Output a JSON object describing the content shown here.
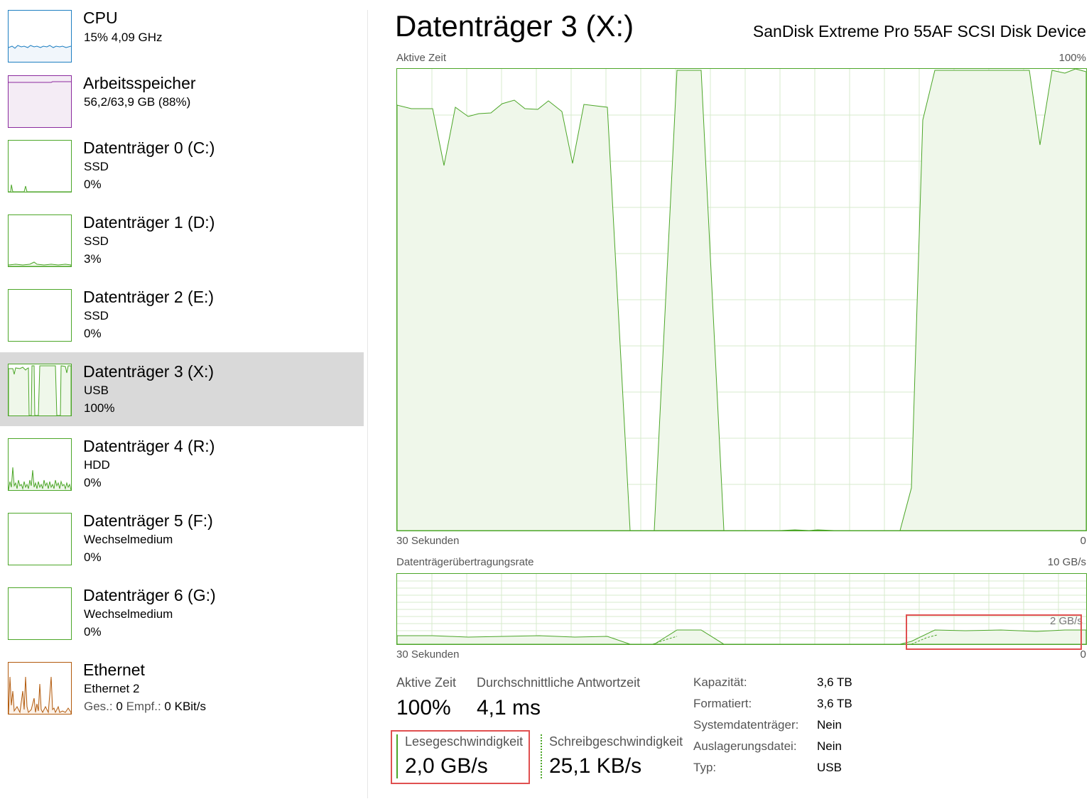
{
  "sidebar": {
    "items": [
      {
        "title": "CPU",
        "line1": "15%  4,09 GHz",
        "kind": "cpu"
      },
      {
        "title": "Arbeitsspeicher",
        "line1": "56,2/63,9 GB (88%)",
        "kind": "memory"
      },
      {
        "title": "Datenträger 0 (C:)",
        "line1": "SSD",
        "line2": "0%",
        "kind": "disk"
      },
      {
        "title": "Datenträger 1 (D:)",
        "line1": "SSD",
        "line2": "3%",
        "kind": "disk"
      },
      {
        "title": "Datenträger 2 (E:)",
        "line1": "SSD",
        "line2": "0%",
        "kind": "disk"
      },
      {
        "title": "Datenträger 3 (X:)",
        "line1": "USB",
        "line2": "100%",
        "kind": "disk",
        "selected": true
      },
      {
        "title": "Datenträger 4 (R:)",
        "line1": "HDD",
        "line2": "0%",
        "kind": "disk"
      },
      {
        "title": "Datenträger 5 (F:)",
        "line1": "Wechselmedium",
        "line2": "0%",
        "kind": "disk"
      },
      {
        "title": "Datenträger 6 (G:)",
        "line1": "Wechselmedium",
        "line2": "0%",
        "kind": "disk"
      },
      {
        "title": "Ethernet",
        "line1": "Ethernet 2",
        "line2_label_send": "Ges.:",
        "line2_send": "0",
        "line2_label_recv": "Empf.:",
        "line2_recv": "0 KBit/s",
        "kind": "network"
      }
    ]
  },
  "main": {
    "title": "Datenträger 3 (X:)",
    "device": "SanDisk Extreme Pro 55AF SCSI Disk Device",
    "active_graph": {
      "label": "Aktive Zeit",
      "max_label": "100%",
      "time_label": "30 Sekunden",
      "min_label": "0"
    },
    "transfer_graph": {
      "label": "Datenträgerübertragungsrate",
      "max_label": "10 GB/s",
      "scale_mark": "2 GB/s",
      "time_label": "30 Sekunden",
      "min_label": "0"
    },
    "stats": {
      "active_time_label": "Aktive Zeit",
      "active_time_value": "100%",
      "response_label": "Durchschnittliche Antwortzeit",
      "response_value": "4,1 ms",
      "read_label": "Lesegeschwindigkeit",
      "read_value": "2,0 GB/s",
      "write_label": "Schreibgeschwindigkeit",
      "write_value": "25,1 KB/s"
    },
    "properties": [
      {
        "label": "Kapazität:",
        "value": "3,6 TB"
      },
      {
        "label": "Formatiert:",
        "value": "3,6 TB"
      },
      {
        "label": "Systemdatenträger:",
        "value": "Nein"
      },
      {
        "label": "Auslagerungsdatei:",
        "value": "Nein"
      },
      {
        "label": "Typ:",
        "value": "USB"
      }
    ]
  },
  "colors": {
    "disk": "#4ca628",
    "disk_fill": "#eff7ea",
    "cpu": "#1e7fc2",
    "memory": "#8b2a9e",
    "network": "#b25a0c",
    "selected_bg": "#d9d9d9",
    "highlight": "#e05050"
  }
}
